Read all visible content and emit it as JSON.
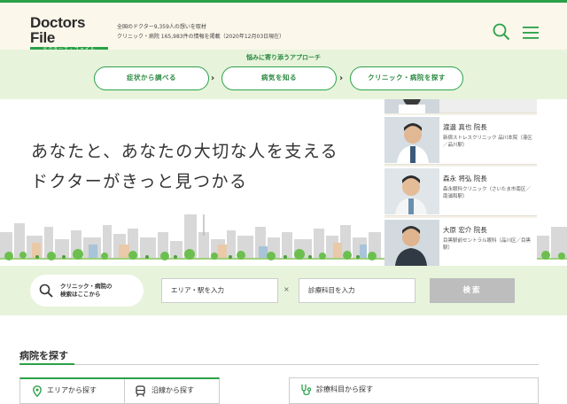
{
  "header": {
    "logo_text": "Doctors File",
    "logo_sub": "ドクターズ・ファイル",
    "stats_line1": "全国のドクター9,359人の想いを取材",
    "stats_line2": "クリニック・病院 165,983件の情報を掲載（2020年12月03日現在）"
  },
  "approach": {
    "title": "悩みに寄り添うアプローチ",
    "buttons": [
      "症状から調べる",
      "病気を知る",
      "クリニック・病院を探す"
    ]
  },
  "hero": {
    "line1": "あなたと、あなたの大切な人を支える",
    "line2": "ドクターがきっと見つかる"
  },
  "doctors": [
    {
      "name": "渡邊 真也 院長",
      "clinic": "新宿ストレスクリニック 品川本院（港区／品川駅）"
    },
    {
      "name": "森永 将弘 院長",
      "clinic": "森永眼科クリニック（さいたま市南区／南浦和駅）"
    },
    {
      "name": "大原 宏介 院長",
      "clinic": "目黒駅前セントラル眼科（品川区／目黒駅）"
    }
  ],
  "search": {
    "label": "クリニック・病院の検索はここから",
    "label_line1": "クリニック・病院の",
    "label_line2": "検索はここから",
    "area_placeholder": "エリア・駅を入力",
    "dept_placeholder": "診療科目を入力",
    "separator": "×",
    "submit": "検索"
  },
  "find": {
    "title": "病院を探す",
    "tabs": [
      "エリアから探す",
      "沿線から探す"
    ],
    "dept_tab": "診療科目から探す"
  },
  "colors": {
    "accent": "#2aa148",
    "header_bg": "#fbf7ea",
    "band_bg": "#e8f3dc",
    "submit_disabled": "#bdbdbd"
  }
}
